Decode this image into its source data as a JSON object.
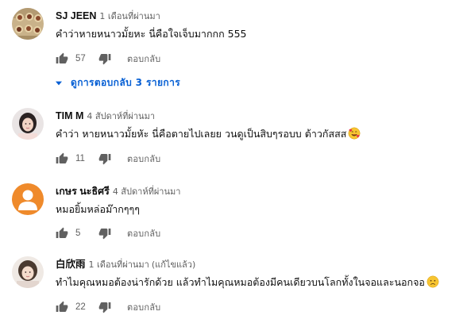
{
  "comments": [
    {
      "author": "SJ JEEN",
      "time": "1 เดือนที่ผ่านมา",
      "edited": "",
      "text": "คำว่าหายหนาวมั้ยหะ นี่คือใจเจ็บมากกก 555",
      "likes": "57",
      "reply_label": "ตอบกลับ",
      "view_replies": "ดูการตอบกลับ 3 รายการ",
      "avatar_icon": "food-photo-avatar",
      "emoji": ""
    },
    {
      "author": "TIM M",
      "time": "4 สัปดาห์ที่ผ่านมา",
      "edited": "",
      "text": "คำว่า หายหนาวมั้ยหัะ นี่คือตายไปเลยย วนดูเป็นสิบๆรอบบ ต้าวกัสสส",
      "likes": "11",
      "reply_label": "ตอบกลับ",
      "avatar_icon": "person-photo-avatar",
      "emoji": "smiling-face-with-hearts-emoji"
    },
    {
      "author": "เกษร นะธิศรี",
      "time": "4 สัปดาห์ที่ผ่านมา",
      "edited": "",
      "text": "หมอยิ้มหล่อม๊ากๆๆๆ",
      "likes": "5",
      "reply_label": "ตอบกลับ",
      "avatar_icon": "default-user-avatar",
      "emoji": ""
    },
    {
      "author": "白欣雨",
      "time": "1 เดือนที่ผ่านมา",
      "edited": "(แก้ไขแล้ว)",
      "text": "ทำไมคุณหมอต้องน่ารักด้วย แล้วทำไมคุณหมอต้องมีคนเดียวบนโลกทั้งในจอและนอกจอ",
      "likes": "22",
      "reply_label": "ตอบกลับ",
      "avatar_icon": "person-photo-avatar",
      "emoji": "sad-face-emoji"
    }
  ],
  "colors": {
    "link_blue": "#065fd4",
    "meta_gray": "#606060",
    "text": "#0f0f0f",
    "default_avatar": "#ef8a2b"
  }
}
